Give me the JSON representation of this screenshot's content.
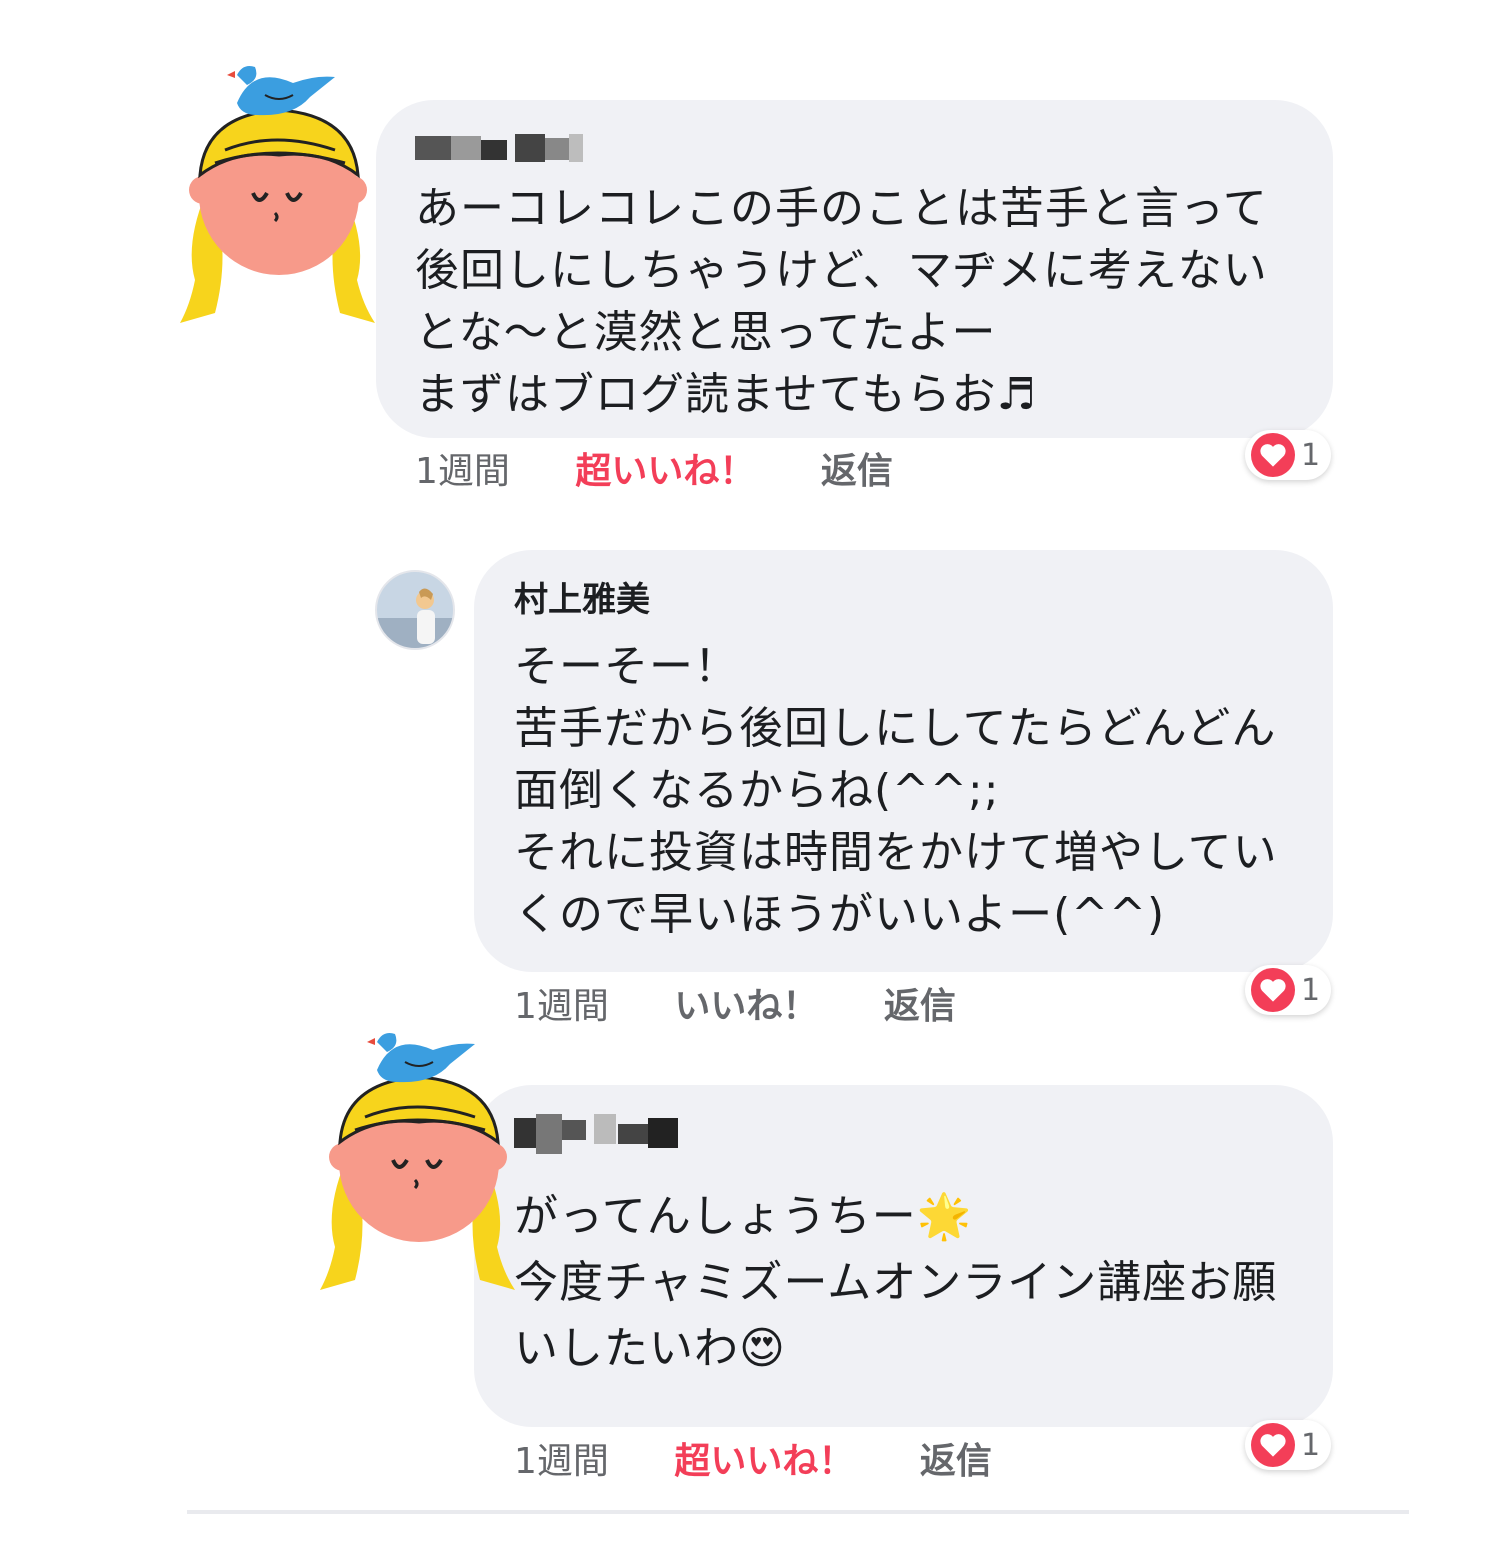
{
  "comments": [
    {
      "author": "",
      "text": "あーコレコレこの手のことは苦手と言って後回しにしちゃうけど、マヂメに考えないとな〜と漠然と思ってたよー\nまずはブログ読ませてもらお♬",
      "time": "1週間",
      "like_label": "超いいね！",
      "reply_label": "返信",
      "reaction_count": "1"
    },
    {
      "author": "村上雅美",
      "text": "そーそー！\n苦手だから後回しにしてたらどんどん面倒くなるからね(^^;;\nそれに投資は時間をかけて増やしていくので早いほうがいいよー(^^)",
      "time": "1週間",
      "like_label": "いいね！",
      "reply_label": "返信",
      "reaction_count": "1"
    },
    {
      "author": "",
      "text": "がってんしょうちー🌟\n今度チャミズームオンライン講座お願いしたいわ😍",
      "time": "1週間",
      "like_label": "超いいね！",
      "reply_label": "返信",
      "reaction_count": "1"
    }
  ],
  "colors": {
    "bubble": "#f0f1f5",
    "love_reaction": "#f33e58",
    "meta_text": "#65676b"
  },
  "icons": [
    "cartoon-girl-avatar-icon",
    "profile-photo-avatar",
    "heart-reaction-icon"
  ]
}
